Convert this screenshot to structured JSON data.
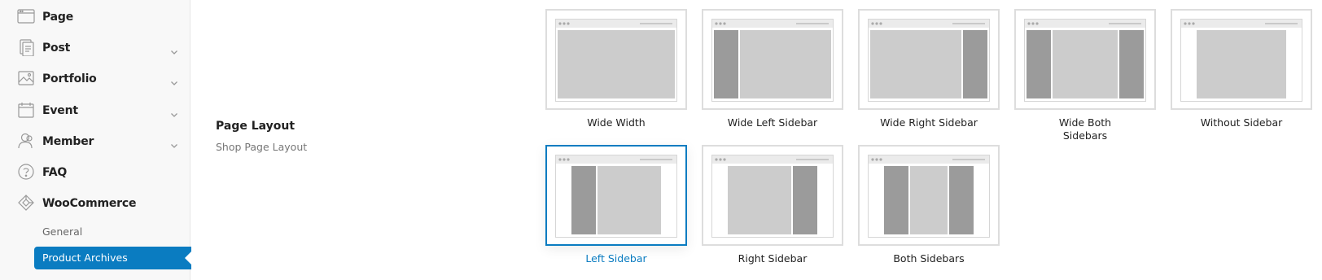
{
  "sidebar": {
    "items": [
      {
        "label": "Page",
        "icon": "page-icon",
        "has_children": false
      },
      {
        "label": "Post",
        "icon": "post-icon",
        "has_children": true
      },
      {
        "label": "Portfolio",
        "icon": "portfolio-icon",
        "has_children": true
      },
      {
        "label": "Event",
        "icon": "event-icon",
        "has_children": true
      },
      {
        "label": "Member",
        "icon": "member-icon",
        "has_children": true
      },
      {
        "label": "FAQ",
        "icon": "faq-icon",
        "has_children": false
      },
      {
        "label": "WooCommerce",
        "icon": "woocommerce-icon",
        "has_children": false
      }
    ],
    "sub_items": [
      {
        "label": "General",
        "active": false
      },
      {
        "label": "Product Archives",
        "active": true
      }
    ]
  },
  "setting": {
    "title": "Page Layout",
    "description": "Shop Page Layout"
  },
  "layouts": [
    {
      "label": "Wide Width",
      "kind": "wide-full",
      "selected": false
    },
    {
      "label": "Wide Left Sidebar",
      "kind": "wide-left",
      "selected": false
    },
    {
      "label": "Wide Right Sidebar",
      "kind": "wide-right",
      "selected": false
    },
    {
      "label": "Wide Both Sidebars",
      "kind": "wide-both",
      "selected": false
    },
    {
      "label": "Without Sidebar",
      "kind": "boxed-none",
      "selected": false
    },
    {
      "label": "Left Sidebar",
      "kind": "boxed-left",
      "selected": true
    },
    {
      "label": "Right Sidebar",
      "kind": "boxed-right",
      "selected": false
    },
    {
      "label": "Both Sidebars",
      "kind": "boxed-both",
      "selected": false
    }
  ],
  "colors": {
    "accent": "#0a7cc1",
    "sidebar_block": "#9b9b9b",
    "content_block": "#cccccc",
    "tile_border": "#dddddd"
  }
}
